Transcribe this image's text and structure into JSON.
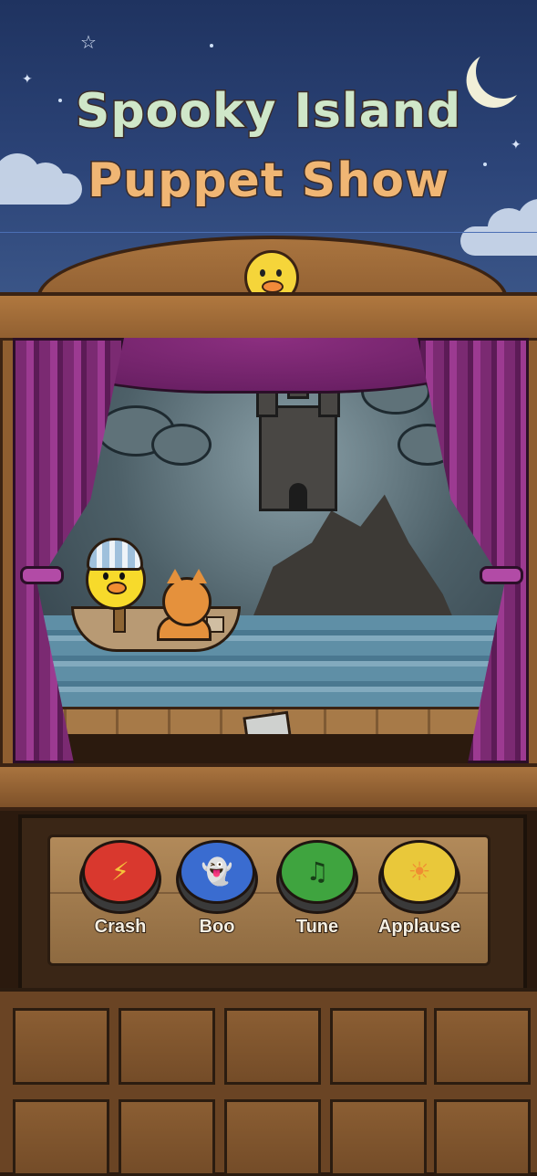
{
  "game": {
    "title_line1": "Spooky Island",
    "title_line2": "Puppet Show"
  },
  "colors": {
    "sky": "#2c4478",
    "wood": "#a9743f",
    "curtain": "#7b2a72",
    "crash": "#d9382e",
    "boo": "#3a6cd0",
    "tune": "#3fa43f",
    "applause": "#e9c83a"
  },
  "stage": {
    "crest_icon": "duck-face-icon",
    "scene": "castle-island-at-night",
    "puppets": [
      "duck-puppet",
      "cat-puppet"
    ]
  },
  "controls": {
    "buttons": [
      {
        "label": "Crash",
        "icon": "lightning-icon"
      },
      {
        "label": "Boo",
        "icon": "ghost-icon"
      },
      {
        "label": "Tune",
        "icon": "music-note-icon"
      },
      {
        "label": "Applause",
        "icon": "sun-icon"
      }
    ]
  }
}
